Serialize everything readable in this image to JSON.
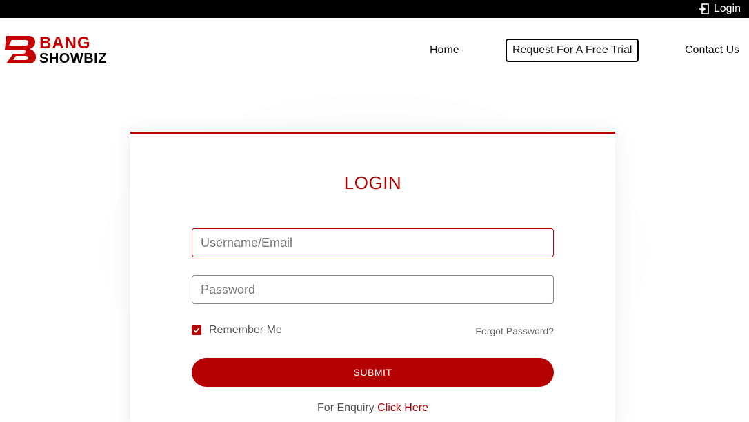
{
  "topbar": {
    "login_label": "Login",
    "icon": "sign-in-icon"
  },
  "header": {
    "logo_line1": "BANG",
    "logo_line2": "SHOWBIZ",
    "nav": {
      "home": "Home",
      "trial": "Request For A Free Trial",
      "contact": "Contact Us"
    }
  },
  "form": {
    "title": "LOGIN",
    "username": {
      "placeholder": "Username/Email",
      "value": ""
    },
    "password": {
      "placeholder": "Password",
      "value": ""
    },
    "remember_label": "Remember Me",
    "remember_checked": true,
    "forgot_label": "Forgot Password?",
    "submit_label": "SUBMIT",
    "enquiry_text": "For Enquiry",
    "enquiry_link": "Click Here"
  },
  "colors": {
    "accent": "#b40000",
    "topbar": "#000000",
    "text": "#222222"
  }
}
